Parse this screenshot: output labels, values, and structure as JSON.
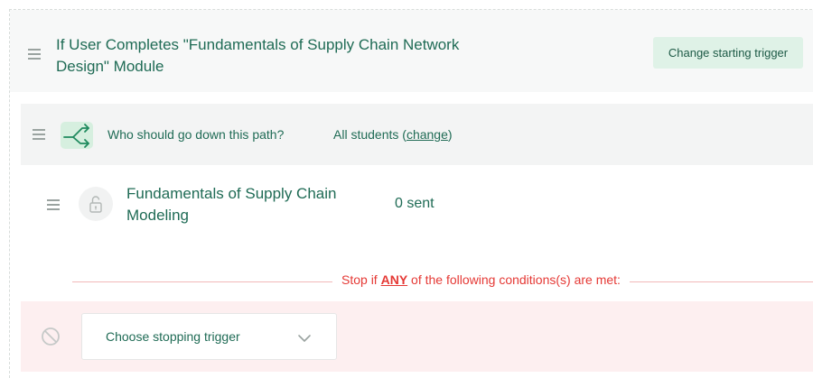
{
  "trigger": {
    "title": "If User Completes \"Fundamentals of Supply Chain Network Design\" Module",
    "change_button_label": "Change starting trigger"
  },
  "path": {
    "question": "Who should go down this path?",
    "audience": "All students",
    "change_link_label": "change"
  },
  "module": {
    "title": "Fundamentals of Supply Chain Modeling",
    "sent_label": "0 sent"
  },
  "stop_conditions": {
    "prefix": "Stop if ",
    "keyword": "ANY",
    "suffix": " of the following conditions(s) are met:",
    "select_label": "Choose stopping trigger"
  },
  "colors": {
    "accent_green": "#1f6b55",
    "button_bg": "#dff2e7",
    "stop_red": "#e53935",
    "stop_bg": "#fdeff0"
  },
  "icons": [
    "drag-handle-icon",
    "split-path-icon",
    "lock-icon",
    "ban-icon",
    "chevron-down-icon"
  ]
}
